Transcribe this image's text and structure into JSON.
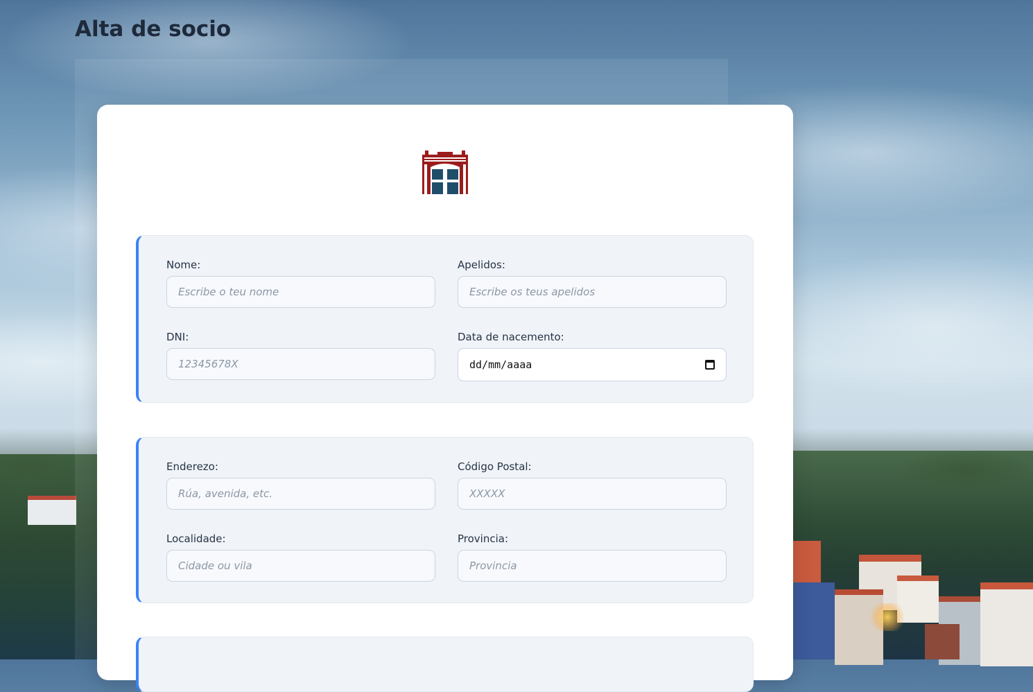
{
  "page": {
    "title": "Alta de socio"
  },
  "colors": {
    "accent": "#3b82f6",
    "logo_red": "#9b1c1c",
    "logo_blue": "#1f4e6b",
    "title_text": "#1e2a3b"
  },
  "logo": {
    "icon": "building-emblem-icon"
  },
  "personal": {
    "nome": {
      "label": "Nome:",
      "placeholder": "Escribe o teu nome"
    },
    "apelidos": {
      "label": "Apelidos:",
      "placeholder": "Escribe os teus apelidos"
    },
    "dni": {
      "label": "DNI:",
      "placeholder": "12345678X"
    },
    "nacemento": {
      "label": "Data de nacemento:",
      "value": "dd/mm/aaaa",
      "icon": "calendar-icon"
    }
  },
  "address": {
    "enderezo": {
      "label": "Enderezo:",
      "placeholder": "Rúa, avenida, etc."
    },
    "codigo_postal": {
      "label": "Código Postal:",
      "placeholder": "XXXXX"
    },
    "localidade": {
      "label": "Localidade:",
      "placeholder": "Cidade ou vila"
    },
    "provincia": {
      "label": "Provincia:",
      "placeholder": "Provincia"
    }
  }
}
